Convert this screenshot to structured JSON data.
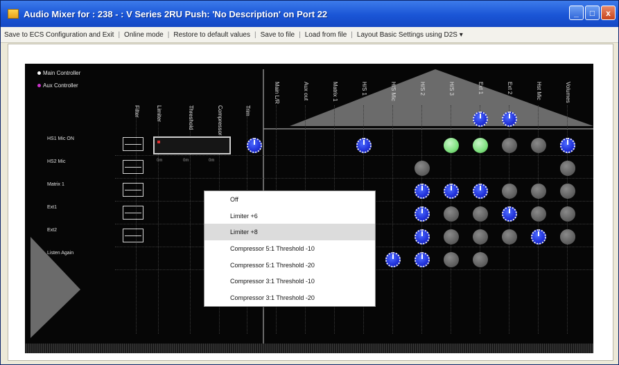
{
  "window": {
    "title": "Audio Mixer for : 238 - : V Series 2RU Push: 'No Description' on Port 22",
    "buttons": [
      "_",
      "□",
      "x"
    ]
  },
  "menubar": {
    "items": [
      "Save to ECS Configuration and Exit",
      "Online mode",
      "Restore to default values",
      "Save to file",
      "Load from file",
      "Layout Basic Settings using D2S ▾"
    ]
  },
  "legend": {
    "main": {
      "label": "Main Controller",
      "color": "#ffffff"
    },
    "aux": {
      "label": "Aux Controller",
      "color": "#cc33cc"
    }
  },
  "columns": {
    "left": [
      "Filter",
      "Limiter",
      "Threshold",
      "Compressor",
      "Trim"
    ],
    "right": [
      "Main L/R",
      "Aux out",
      "Matrix 1",
      "H/S 1",
      "H/S Mic",
      "H/S 2",
      "H/S 3",
      "Ext 1",
      "Ext 2",
      "Hst Mic",
      "Volumes"
    ]
  },
  "rows": [
    "HS1 Mic ON",
    "HS2 Mic",
    "Matrix 1",
    "Ext1",
    "Ext2",
    "Listen Again"
  ],
  "limiter_small_labels": [
    "0m",
    "0m",
    "0m"
  ],
  "knob_icon_name": "knob-icon",
  "context_menu": {
    "items": [
      "Off",
      "Limiter +6",
      "Limiter +8",
      "Compressor 5:1 Threshold -10",
      "Compressor 5:1 Threshold -20",
      "Compressor 3:1 Threshold -10",
      "Compressor 3:1 Threshold -20"
    ],
    "highlighted": "Limiter +8"
  },
  "colors": {
    "titlebar": "#1a55d6",
    "mixer_bg": "#060606",
    "knob_blue": "#1f2fd8",
    "knob_green": "#7ee07e",
    "knob_off": "#5a5a5a"
  }
}
